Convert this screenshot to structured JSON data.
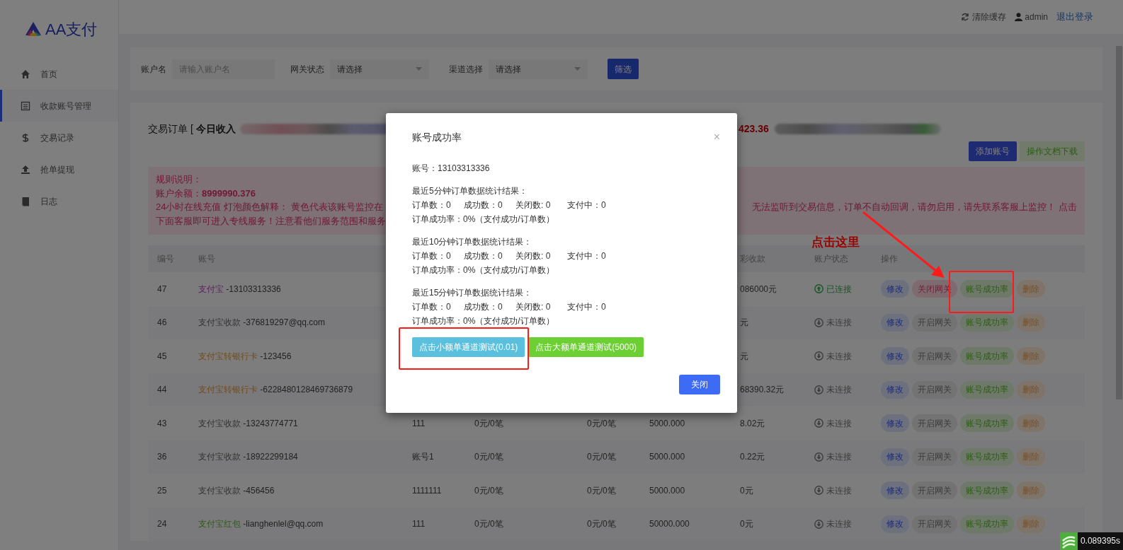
{
  "sidebar": {
    "logo": "AA支付",
    "items": [
      {
        "label": "首页",
        "selected": false
      },
      {
        "label": "收款账号管理",
        "selected": true
      },
      {
        "label": "交易记录",
        "selected": false
      },
      {
        "label": "抢单提现",
        "selected": false
      },
      {
        "label": "日志",
        "selected": false
      }
    ]
  },
  "topbar": {
    "clear_cache": "清除缓存",
    "user": "admin",
    "logout": "退出登录"
  },
  "filter": {
    "fields": [
      {
        "label": "账户名",
        "kind": "input",
        "placeholder": "请输入账户名"
      },
      {
        "label": "网关状态",
        "kind": "select",
        "value": "请选择"
      },
      {
        "label": "渠道选择",
        "kind": "select",
        "value": "请选择"
      }
    ],
    "button": "筛选"
  },
  "orders": {
    "title": "交易订单 [ **今日收入**",
    "amount": "423.36",
    "buttons": [
      {
        "label": "添加账号",
        "kind": "primary"
      },
      {
        "label": "操作文档下载",
        "kind": "success"
      }
    ]
  },
  "notice": {
    "heading": "规则说明：",
    "balance": "账户余额：**8999990.376**",
    "lines": [
      {
        "left": "24小时在线充值 灯泡颜色解释： 黄色代表该账号监控在",
        "right": "无法监听到交易信息，订单不自动回调，请勿启用，请先联系客服上监控！ 点击"
      },
      {
        "left": "下面客服即可进入专线服务！注意看他们服务范围和服务"
      }
    ]
  },
  "table": {
    "header": {
      "id": "编号",
      "account": "账号",
      "income": "彩收款",
      "status": "账户状态",
      "actions": "操作"
    },
    "rows": [
      {
        "id": "47",
        "type": {
          "text": "支付宝",
          "kind": "alipay"
        },
        "number": "-13103313336",
        "income": "086000元",
        "connected": true,
        "status": "已连接",
        "actions": [
          {
            "label": "修改",
            "kind": "edit"
          },
          {
            "label": "关闭网关",
            "kind": "close"
          },
          {
            "label": "账号成功率",
            "kind": "rate"
          },
          {
            "label": "删除",
            "kind": "delete"
          }
        ]
      },
      {
        "id": "46",
        "type": {
          "text": "支付宝收款",
          "kind": "collect"
        },
        "number": "-376819297@qq.com",
        "income": "元",
        "connected": false,
        "status": "未连接",
        "actions": [
          {
            "label": "修改",
            "kind": "edit"
          },
          {
            "label": "开启网关",
            "kind": "open"
          },
          {
            "label": "账号成功率",
            "kind": "rate"
          },
          {
            "label": "删除",
            "kind": "delete"
          }
        ]
      },
      {
        "id": "45",
        "type": {
          "text": "支付宝转银行卡",
          "kind": "bank"
        },
        "number": "-123456",
        "income": "元",
        "connected": false,
        "status": "未连接",
        "actions": [
          {
            "label": "修改",
            "kind": "edit"
          },
          {
            "label": "开启网关",
            "kind": "open"
          },
          {
            "label": "账号成功率",
            "kind": "rate"
          },
          {
            "label": "删除",
            "kind": "delete"
          }
        ]
      },
      {
        "id": "44",
        "type": {
          "text": "支付宝转银行卡",
          "kind": "bank"
        },
        "number": "-6228480128469736879",
        "income": "68390.32元",
        "connected": false,
        "status": "未连接",
        "actions": [
          {
            "label": "修改",
            "kind": "edit"
          },
          {
            "label": "开启网关",
            "kind": "open"
          },
          {
            "label": "账号成功率",
            "kind": "rate"
          },
          {
            "label": "删除",
            "kind": "delete"
          }
        ]
      },
      {
        "id": "43",
        "type": {
          "text": "支付宝收款",
          "kind": "collect"
        },
        "number": "-13243774771",
        "column_3": "111",
        "column_4": "0元/0笔",
        "column_5": "0元/0笔",
        "column_6": "5000.000",
        "income": "8.02元",
        "connected": false,
        "status": "未连接",
        "actions": [
          {
            "label": "修改",
            "kind": "edit"
          },
          {
            "label": "开启网关",
            "kind": "open"
          },
          {
            "label": "账号成功率",
            "kind": "rate"
          },
          {
            "label": "删除",
            "kind": "delete"
          }
        ]
      },
      {
        "id": "36",
        "type": {
          "text": "支付宝收款",
          "kind": "collect"
        },
        "number": "-18922299184",
        "column_3": "账号1",
        "column_4": "0元/0笔",
        "column_5": "0元/0笔",
        "column_6": "5000.000",
        "income": "0.22元",
        "connected": false,
        "status": "未连接",
        "actions": [
          {
            "label": "修改",
            "kind": "edit"
          },
          {
            "label": "开启网关",
            "kind": "open"
          },
          {
            "label": "账号成功率",
            "kind": "rate"
          },
          {
            "label": "删除",
            "kind": "delete"
          }
        ]
      },
      {
        "id": "25",
        "type": {
          "text": "支付宝收款",
          "kind": "collect"
        },
        "number": "-456456",
        "column_3": "1111111",
        "column_4": "0元/0笔",
        "column_5": "0元/0笔",
        "column_6": "5000.000",
        "income": "0元",
        "connected": false,
        "status": "未连接",
        "actions": [
          {
            "label": "修改",
            "kind": "edit"
          },
          {
            "label": "开启网关",
            "kind": "open"
          },
          {
            "label": "账号成功率",
            "kind": "rate"
          },
          {
            "label": "删除",
            "kind": "delete"
          }
        ]
      },
      {
        "id": "24",
        "type": {
          "text": "支付宝红包",
          "kind": "redpacket"
        },
        "number": "-lianghenlel@qq.com",
        "column_3": "111",
        "column_4": "0元/0笔",
        "column_5": "0元/0笔",
        "column_6": "50000.000",
        "income": "0元",
        "connected": false,
        "status": "未连接",
        "actions": [
          {
            "label": "修改",
            "kind": "edit"
          },
          {
            "label": "开启网关",
            "kind": "open"
          },
          {
            "label": "账号成功率",
            "kind": "rate"
          },
          {
            "label": "删除",
            "kind": "delete"
          }
        ]
      }
    ]
  },
  "modal": {
    "title": "账号成功率",
    "close": "×",
    "account": "账号：13103313336",
    "groups": [
      {
        "heading": "最近5分钟订单数据统计结果：",
        "stats": [
          "订单数：0",
          "成功数：0",
          "关闭数: 0",
          "支付中：0"
        ],
        "rate": "订单成功率：0%（支付成功/订单数）"
      },
      {
        "heading": "最近10分钟订单数据统计结果：",
        "stats": [
          "订单数：0",
          "成功数：0",
          "关闭数: 0",
          "支付中：0"
        ],
        "rate": "订单成功率：0%（支付成功/订单数）"
      },
      {
        "heading": "最近15分钟订单数据统计结果：",
        "stats": [
          "订单数：0",
          "成功数：0",
          "关闭数: 0",
          "支付中：0"
        ],
        "rate": "订单成功率：0%（支付成功/订单数）"
      }
    ],
    "test_buttons": [
      {
        "label": "点击小额单通道测试(0.01)",
        "kind": "info"
      },
      {
        "label": "点击大额单通道测试(5000)",
        "kind": "success"
      }
    ],
    "footer_button": "关闭"
  },
  "annotation": {
    "text": "点击这里"
  },
  "timing": "0.089395s"
}
